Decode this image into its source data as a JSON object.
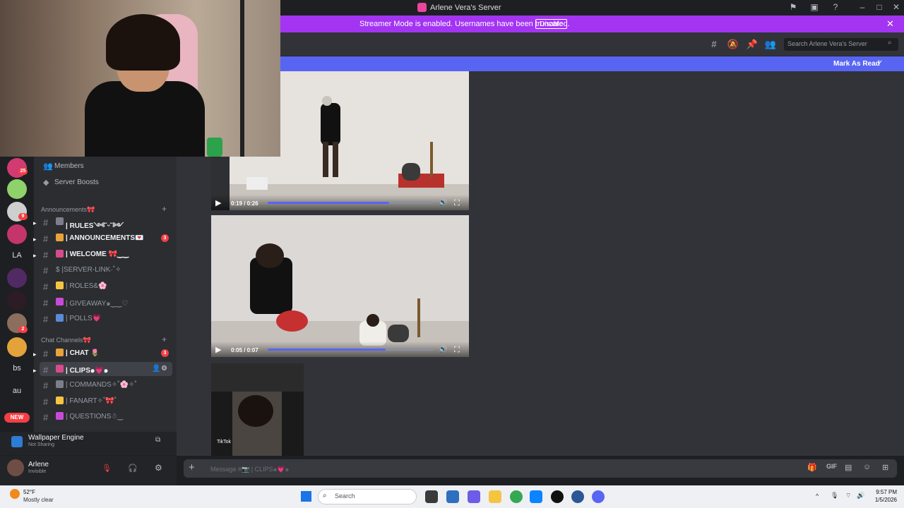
{
  "window": {
    "title": "Arlene Vera's Server",
    "controls": [
      "minimize",
      "maximize",
      "close"
    ]
  },
  "streamer_banner": {
    "text": "Streamer Mode is enabled. Usernames have been truncated.",
    "button": "Disable"
  },
  "header": {
    "search_placeholder": "Search Arlene Vera's Server"
  },
  "mark_read": {
    "label": "Mark As Read"
  },
  "servers": [
    {
      "badge": "25"
    },
    {
      "badge": ""
    },
    {
      "badge": "9"
    },
    {
      "badge": ""
    },
    {
      "text": "LA"
    },
    {
      "badge": ""
    },
    {
      "badge": ""
    },
    {
      "badge": "2"
    },
    {
      "badge": ""
    },
    {
      "text": "bs"
    },
    {
      "text": "au"
    }
  ],
  "new_badge": "NEW",
  "channel_list": {
    "top_items": [
      {
        "label": "Members",
        "icon": "members-icon"
      },
      {
        "label": "Server Boosts",
        "icon": "boost-icon"
      }
    ],
    "categories": [
      {
        "name": "Announcements🎀",
        "channels": [
          {
            "label": "| RULES༺˘ᵕ˘༻",
            "unread": true,
            "mention": "",
            "emoji": "📖"
          },
          {
            "label": "| ANNOUNCEMENTS💌",
            "unread": true,
            "mention": "3",
            "emoji": "📣"
          },
          {
            "label": "| WELCOME 🎀‿‿",
            "unread": true,
            "mention": "",
            "emoji": "💌"
          },
          {
            "label": "$ |SERVER-LINK·˚✧",
            "unread": false,
            "mention": "",
            "emoji": ""
          },
          {
            "label": "| ROLES&🌸",
            "unread": false,
            "mention": "",
            "emoji": "📒"
          },
          {
            "label": "| GIVEAWAY๑‿‿♡",
            "unread": false,
            "mention": "",
            "emoji": "🎉"
          },
          {
            "label": "| POLLS💗",
            "unread": false,
            "mention": "",
            "emoji": "📊"
          }
        ]
      },
      {
        "name": "Chat Channels🎀",
        "channels": [
          {
            "label": "| CHAT 🌷",
            "unread": true,
            "mention": "3",
            "emoji": "💬"
          },
          {
            "label": "| CLIPS๑💗๑",
            "unread": true,
            "mention": "",
            "emoji": "📷",
            "selected": true
          },
          {
            "label": "| COMMANDS✧˚🌸✧˚",
            "unread": false,
            "mention": "",
            "emoji": "🤖"
          },
          {
            "label": "| FANART✧˚🎀˚",
            "unread": false,
            "mention": "",
            "emoji": "🎨"
          },
          {
            "label": "| QUESTIONS☃‿",
            "unread": false,
            "mention": "",
            "emoji": "❓"
          }
        ]
      }
    ]
  },
  "wallpaper_panel": {
    "title": "Wallpaper Engine",
    "subtitle": "Not Sharing"
  },
  "user_panel": {
    "name": "Arlene",
    "status": "Invisible"
  },
  "videos": [
    {
      "time": "0:19 / 0:26",
      "progress": 0.73
    },
    {
      "time": "0:05 / 0:07",
      "progress": 0.71
    },
    {
      "overlay": "TikTok"
    }
  ],
  "message_input": {
    "placeholder": "Message #📷 | CLIPS๑💗๑"
  },
  "taskbar": {
    "weather_temp": "52°F",
    "weather_text": "Mostly clear",
    "search": "Search",
    "time": "9:57 PM",
    "date": "1/5/2026"
  },
  "colors": {
    "blurple": "#5865f2",
    "streamer_purple": "#a335f2",
    "mention_red": "#f23f43"
  }
}
